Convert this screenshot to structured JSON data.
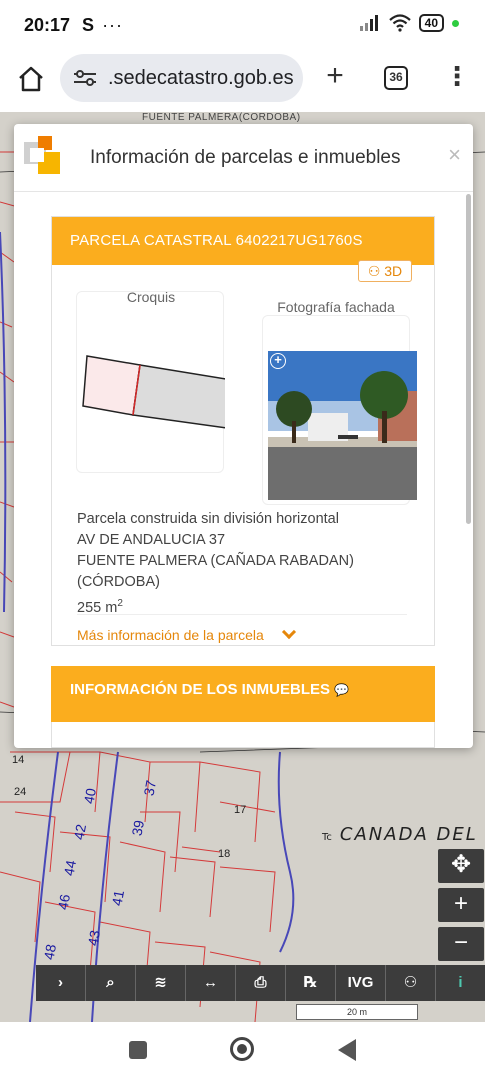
{
  "status_bar": {
    "time": "20:17",
    "app_indicator": "S",
    "more": "···",
    "battery": "40"
  },
  "browser": {
    "url": ".sedecatastro.gob.es",
    "tab_count": "36"
  },
  "map": {
    "top_label": "FUENTE PALMERA(CORDOBA)",
    "street_prefix": "Tc",
    "street_label": "CANADA DEL",
    "parcel_numbers": [
      "40",
      "37",
      "42",
      "39",
      "44",
      "41",
      "46",
      "43",
      "48",
      "18",
      "17",
      "14",
      "24"
    ],
    "scale_label": "20 m"
  },
  "toolbar": {
    "items": [
      "›",
      "⌕",
      "≋",
      "↔",
      "⎙",
      "℞",
      "IVG",
      "⚇",
      "i"
    ]
  },
  "zoom": {
    "locate": "✥",
    "zoom_in": "+",
    "zoom_out": "−"
  },
  "modal": {
    "title": "Información de parcelas e inmuebles",
    "close": "×",
    "parcel_header": "PARCELA CATASTRAL 6402217UG1760S",
    "btn_3d": "3D",
    "croquis_label": "Croquis",
    "foto_label": "Fotografía fachada",
    "details": {
      "line1": "Parcela construida sin división horizontal",
      "line2": "AV DE ANDALUCIA 37",
      "line3": "FUENTE PALMERA (CAÑADA RABADAN)",
      "line4": "(CÓRDOBA)",
      "area": "255 m",
      "area_sup": "2"
    },
    "mas_info": "Más información de la parcela",
    "inmuebles_header": "INFORMACIÓN DE LOS INMUEBLES",
    "inmuebles_icon": "💬"
  }
}
